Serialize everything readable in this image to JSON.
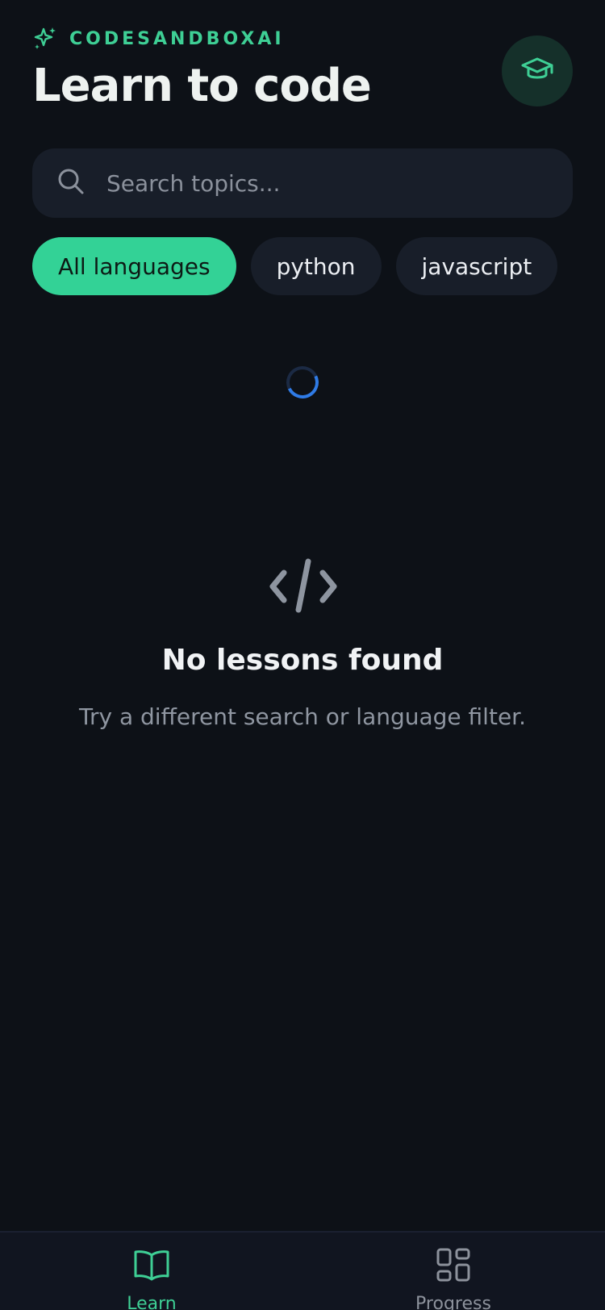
{
  "header": {
    "brand_name": "CODESANDBOXAI",
    "brand_icon": "sparkles-icon",
    "title": "Learn to code",
    "profile_icon": "graduation-cap-icon"
  },
  "search": {
    "placeholder": "Search topics...",
    "value": "",
    "icon": "search-icon"
  },
  "filters": {
    "chips": [
      {
        "label": "All languages",
        "active": true
      },
      {
        "label": "python",
        "active": false
      },
      {
        "label": "javascript",
        "active": false
      }
    ]
  },
  "loading": {
    "icon": "loading-spinner"
  },
  "empty_state": {
    "icon": "code-icon",
    "title": "No lessons found",
    "subtitle": "Try a different search or language filter."
  },
  "bottom_nav": {
    "items": [
      {
        "label": "Learn",
        "icon": "book-open-icon",
        "active": true
      },
      {
        "label": "Progress",
        "icon": "grid-icon",
        "active": false
      }
    ]
  },
  "colors": {
    "background": "#0d1117",
    "accent": "#33d296",
    "surface": "#181e29",
    "spinner": "#2f7be6"
  }
}
